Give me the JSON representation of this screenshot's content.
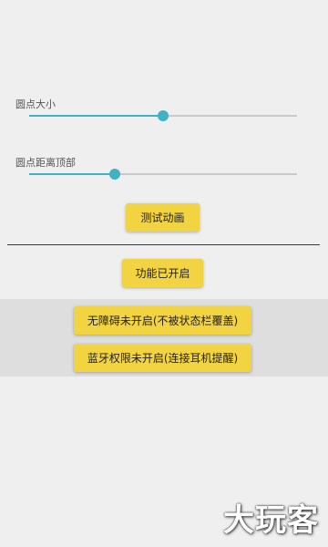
{
  "settings": {
    "dot_size": {
      "label": "圆点大小",
      "value_fraction": 0.5
    },
    "dot_top_distance": {
      "label": "圆点距离顶部",
      "value_fraction": 0.32
    },
    "accent_color": "#3fb3c4",
    "button_color": "#f2d342"
  },
  "buttons": {
    "test_animation": "测试动画",
    "function_enabled": "功能已开启",
    "accessibility_off": "无障碍未开启(不被状态栏覆盖)",
    "bluetooth_off": "蓝牙权限未开启(连接耳机提醒)"
  },
  "watermark": "大玩客"
}
